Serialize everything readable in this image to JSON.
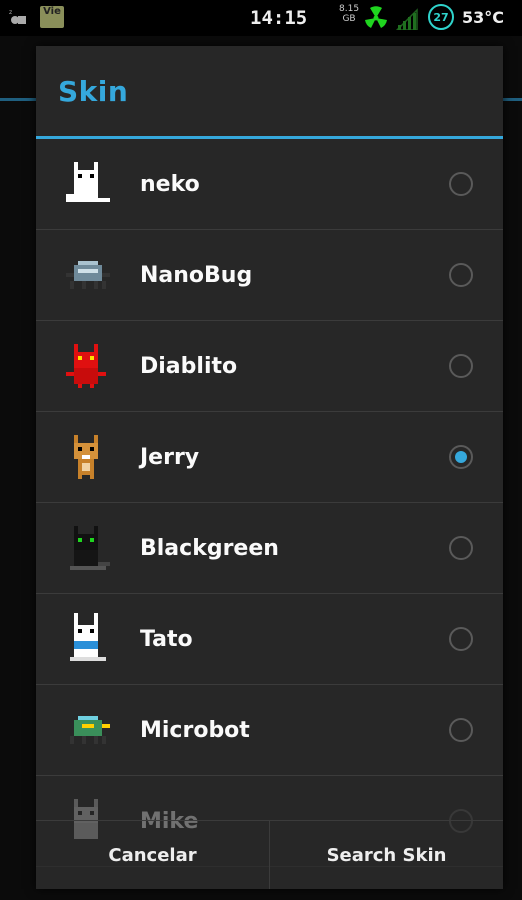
{
  "statusbar": {
    "time": "14:15",
    "calendar_label": "Vie",
    "data_top": "8.15",
    "data_bottom": "GB",
    "battery": "27",
    "temperature": "53°C"
  },
  "dialog": {
    "title": "Skin",
    "items": [
      {
        "label": "neko",
        "icon": "white-cat-icon",
        "checked": false
      },
      {
        "label": "NanoBug",
        "icon": "nanobug-icon",
        "checked": false
      },
      {
        "label": "Diablito",
        "icon": "red-devil-cat-icon",
        "checked": false
      },
      {
        "label": "Jerry",
        "icon": "brown-dog-icon",
        "checked": true
      },
      {
        "label": "Blackgreen",
        "icon": "black-cat-icon",
        "checked": false
      },
      {
        "label": "Tato",
        "icon": "white-rabbit-icon",
        "checked": false
      },
      {
        "label": "Microbot",
        "icon": "microbot-icon",
        "checked": false
      },
      {
        "label": "Mike",
        "icon": "gray-cat-icon",
        "checked": false
      }
    ],
    "cancel_label": "Cancelar",
    "search_label": "Search Skin"
  },
  "colors": {
    "accent": "#35a8dc",
    "dialog_bg": "#272727",
    "divider": "#3b3b3b"
  }
}
